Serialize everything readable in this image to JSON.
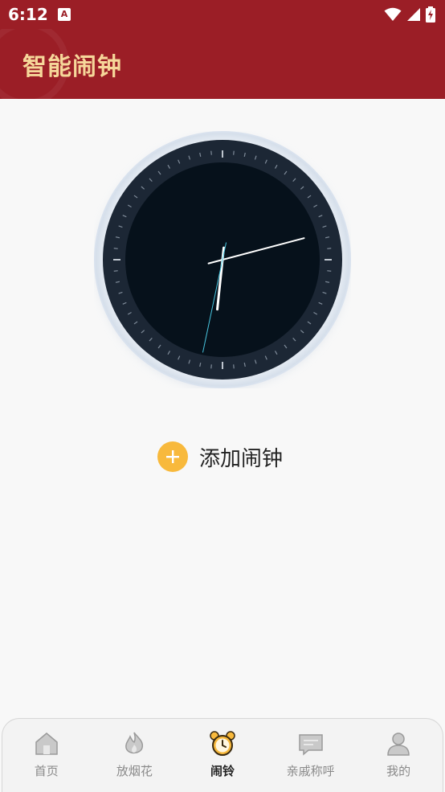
{
  "status_bar": {
    "time": "6:12",
    "notification_icon": "a-letter-icon",
    "icons": [
      "wifi-icon",
      "signal-icon",
      "battery-charging-icon"
    ]
  },
  "header": {
    "title": "智能闹钟",
    "background_color": "#9b1e26",
    "title_color": "#f6d79a"
  },
  "clock": {
    "type": "analog",
    "hour": 6,
    "minute": 12,
    "second": 32,
    "face_color": "#061019"
  },
  "add_alarm": {
    "label": "添加闹钟",
    "icon": "plus-icon",
    "accent_color": "#f8b93c"
  },
  "bottom_nav": {
    "items": [
      {
        "label": "首页",
        "icon": "home-icon",
        "active": false
      },
      {
        "label": "放烟花",
        "icon": "flame-icon",
        "active": false
      },
      {
        "label": "闹铃",
        "icon": "alarm-clock-icon",
        "active": true
      },
      {
        "label": "亲戚称呼",
        "icon": "chat-icon",
        "active": false
      },
      {
        "label": "我的",
        "icon": "user-icon",
        "active": false
      }
    ]
  }
}
